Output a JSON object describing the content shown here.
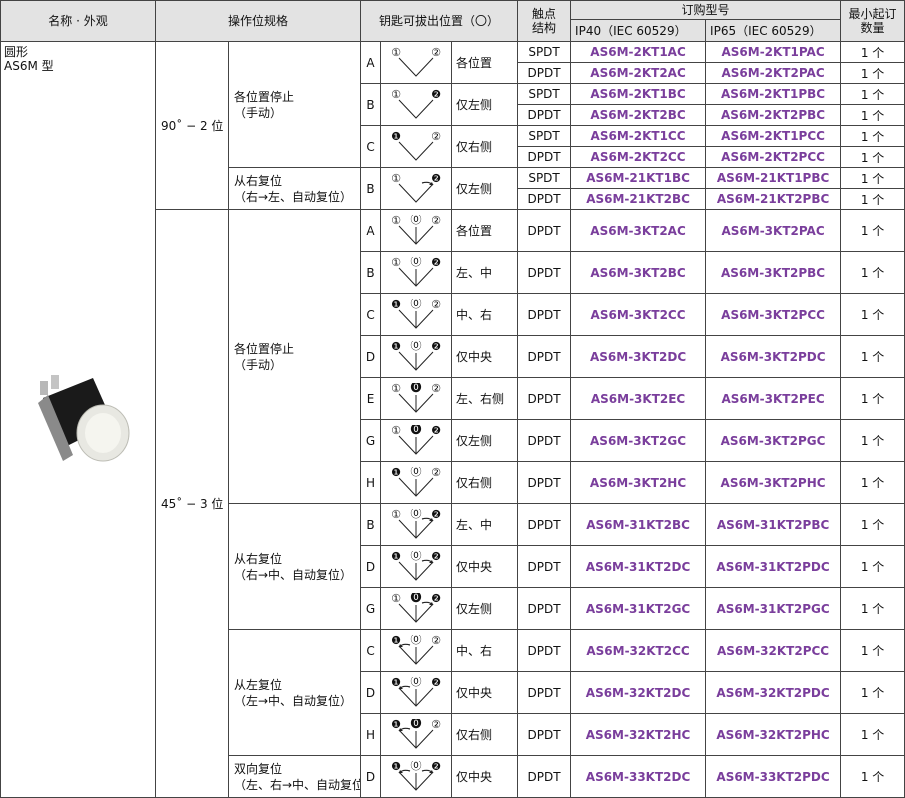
{
  "header": {
    "col_name": "名称 · 外观",
    "col_op": "操作位规格",
    "col_key": "钥匙可拔出位置（〇）",
    "col_contact_1": "触点",
    "col_contact_2": "结构",
    "col_order": "订购型号",
    "col_ip40": "IP40（IEC 60529）",
    "col_ip65": "IP65（IEC 60529）",
    "col_min_1": "最小起订",
    "col_min_2": "数量"
  },
  "product": {
    "name_1": "圆形",
    "name_2": "AS6M 型"
  },
  "angle_90": "90˚ − 2 位",
  "angle_45": "45˚ − 3 位",
  "groups": [
    {
      "l1": "各位置停止",
      "l2": "（手动）"
    },
    {
      "l1": "从右复位",
      "l2": "（右→左、自动复位）"
    },
    {
      "l1": "各位置停止",
      "l2": "（手动）"
    },
    {
      "l1": "从右复位",
      "l2": "（右→中、自动复位）"
    },
    {
      "l1": "从左复位",
      "l2": "（左→中、自动复位）"
    },
    {
      "l1": "双向复位",
      "l2": "（左、右→中、自动复位）"
    }
  ],
  "rows": [
    {
      "code": "A",
      "pos": "各位置",
      "contact": "SPDT",
      "ip40": "AS6M-2KT1AC",
      "ip65": "AS6M-2KT1PAC",
      "min": "1 个"
    },
    {
      "code": "",
      "pos": "",
      "contact": "DPDT",
      "ip40": "AS6M-2KT2AC",
      "ip65": "AS6M-2KT2PAC",
      "min": "1 个"
    },
    {
      "code": "B",
      "pos": "仅左侧",
      "contact": "SPDT",
      "ip40": "AS6M-2KT1BC",
      "ip65": "AS6M-2KT1PBC",
      "min": "1 个"
    },
    {
      "code": "",
      "pos": "",
      "contact": "DPDT",
      "ip40": "AS6M-2KT2BC",
      "ip65": "AS6M-2KT2PBC",
      "min": "1 个"
    },
    {
      "code": "C",
      "pos": "仅右侧",
      "contact": "SPDT",
      "ip40": "AS6M-2KT1CC",
      "ip65": "AS6M-2KT1PCC",
      "min": "1 个"
    },
    {
      "code": "",
      "pos": "",
      "contact": "DPDT",
      "ip40": "AS6M-2KT2CC",
      "ip65": "AS6M-2KT2PCC",
      "min": "1 个"
    },
    {
      "code": "B",
      "pos": "仅左侧",
      "contact": "SPDT",
      "ip40": "AS6M-21KT1BC",
      "ip65": "AS6M-21KT1PBC",
      "min": "1 个"
    },
    {
      "code": "",
      "pos": "",
      "contact": "DPDT",
      "ip40": "AS6M-21KT2BC",
      "ip65": "AS6M-21KT2PBC",
      "min": "1 个"
    },
    {
      "code": "A",
      "pos": "各位置",
      "contact": "DPDT",
      "ip40": "AS6M-3KT2AC",
      "ip65": "AS6M-3KT2PAC",
      "min": "1 个"
    },
    {
      "code": "B",
      "pos": "左、中",
      "contact": "DPDT",
      "ip40": "AS6M-3KT2BC",
      "ip65": "AS6M-3KT2PBC",
      "min": "1 个"
    },
    {
      "code": "C",
      "pos": "中、右",
      "contact": "DPDT",
      "ip40": "AS6M-3KT2CC",
      "ip65": "AS6M-3KT2PCC",
      "min": "1 个"
    },
    {
      "code": "D",
      "pos": "仅中央",
      "contact": "DPDT",
      "ip40": "AS6M-3KT2DC",
      "ip65": "AS6M-3KT2PDC",
      "min": "1 个"
    },
    {
      "code": "E",
      "pos": "左、右侧",
      "contact": "DPDT",
      "ip40": "AS6M-3KT2EC",
      "ip65": "AS6M-3KT2PEC",
      "min": "1 个"
    },
    {
      "code": "G",
      "pos": "仅左侧",
      "contact": "DPDT",
      "ip40": "AS6M-3KT2GC",
      "ip65": "AS6M-3KT2PGC",
      "min": "1 个"
    },
    {
      "code": "H",
      "pos": "仅右侧",
      "contact": "DPDT",
      "ip40": "AS6M-3KT2HC",
      "ip65": "AS6M-3KT2PHC",
      "min": "1 个"
    },
    {
      "code": "B",
      "pos": "左、中",
      "contact": "DPDT",
      "ip40": "AS6M-31KT2BC",
      "ip65": "AS6M-31KT2PBC",
      "min": "1 个"
    },
    {
      "code": "D",
      "pos": "仅中央",
      "contact": "DPDT",
      "ip40": "AS6M-31KT2DC",
      "ip65": "AS6M-31KT2PDC",
      "min": "1 个"
    },
    {
      "code": "G",
      "pos": "仅左侧",
      "contact": "DPDT",
      "ip40": "AS6M-31KT2GC",
      "ip65": "AS6M-31KT2PGC",
      "min": "1 个"
    },
    {
      "code": "C",
      "pos": "中、右",
      "contact": "DPDT",
      "ip40": "AS6M-32KT2CC",
      "ip65": "AS6M-32KT2PCC",
      "min": "1 个"
    },
    {
      "code": "D",
      "pos": "仅中央",
      "contact": "DPDT",
      "ip40": "AS6M-32KT2DC",
      "ip65": "AS6M-32KT2PDC",
      "min": "1 个"
    },
    {
      "code": "H",
      "pos": "仅右侧",
      "contact": "DPDT",
      "ip40": "AS6M-32KT2HC",
      "ip65": "AS6M-32KT2PHC",
      "min": "1 个"
    },
    {
      "code": "D",
      "pos": "仅中央",
      "contact": "DPDT",
      "ip40": "AS6M-33KT2DC",
      "ip65": "AS6M-33KT2PDC",
      "min": "1 个"
    }
  ],
  "diagrams": [
    {
      "labels": [
        "①",
        "②"
      ],
      "filled": [
        false,
        false
      ],
      "arrow": ""
    },
    {
      "labels": [
        "①",
        "❷"
      ],
      "filled": [
        false,
        true
      ],
      "arrow": ""
    },
    {
      "labels": [
        "❶",
        "②"
      ],
      "filled": [
        true,
        false
      ],
      "arrow": ""
    },
    {
      "labels": [
        "①",
        "❷"
      ],
      "filled": [
        false,
        true
      ],
      "arrow": "right"
    },
    {
      "labels": [
        "①",
        "⓪",
        "②"
      ],
      "filled": [
        false,
        false,
        false
      ],
      "arrow": ""
    },
    {
      "labels": [
        "①",
        "⓪",
        "❷"
      ],
      "filled": [
        false,
        false,
        true
      ],
      "arrow": ""
    },
    {
      "labels": [
        "❶",
        "⓪",
        "②"
      ],
      "filled": [
        true,
        false,
        false
      ],
      "arrow": ""
    },
    {
      "labels": [
        "❶",
        "⓪",
        "❷"
      ],
      "filled": [
        true,
        false,
        true
      ],
      "arrow": ""
    },
    {
      "labels": [
        "①",
        "⓿",
        "②"
      ],
      "filled": [
        false,
        true,
        false
      ],
      "arrow": ""
    },
    {
      "labels": [
        "①",
        "⓿",
        "❷"
      ],
      "filled": [
        false,
        true,
        true
      ],
      "arrow": ""
    },
    {
      "labels": [
        "❶",
        "⓿",
        "②"
      ],
      "filled": [
        true,
        true,
        false
      ],
      "arrow": ""
    },
    {
      "labels": [
        "①",
        "⓪",
        "❷"
      ],
      "filled": [
        false,
        false,
        true
      ],
      "arrow": "right"
    },
    {
      "labels": [
        "❶",
        "⓪",
        "❷"
      ],
      "filled": [
        true,
        false,
        true
      ],
      "arrow": "right"
    },
    {
      "labels": [
        "①",
        "⓿",
        "❷"
      ],
      "filled": [
        false,
        true,
        true
      ],
      "arrow": "right"
    },
    {
      "labels": [
        "❶",
        "⓪",
        "②"
      ],
      "filled": [
        true,
        false,
        false
      ],
      "arrow": "left"
    },
    {
      "labels": [
        "❶",
        "⓪",
        "❷"
      ],
      "filled": [
        true,
        false,
        true
      ],
      "arrow": "left"
    },
    {
      "labels": [
        "❶",
        "⓿",
        "②"
      ],
      "filled": [
        true,
        true,
        false
      ],
      "arrow": "left"
    },
    {
      "labels": [
        "❶",
        "⓪",
        "❷"
      ],
      "filled": [
        true,
        false,
        true
      ],
      "arrow": "both"
    }
  ],
  "colors": {
    "model_text": "#7a3e9c",
    "header_bg": "#e3e3e3",
    "border": "#444444"
  }
}
